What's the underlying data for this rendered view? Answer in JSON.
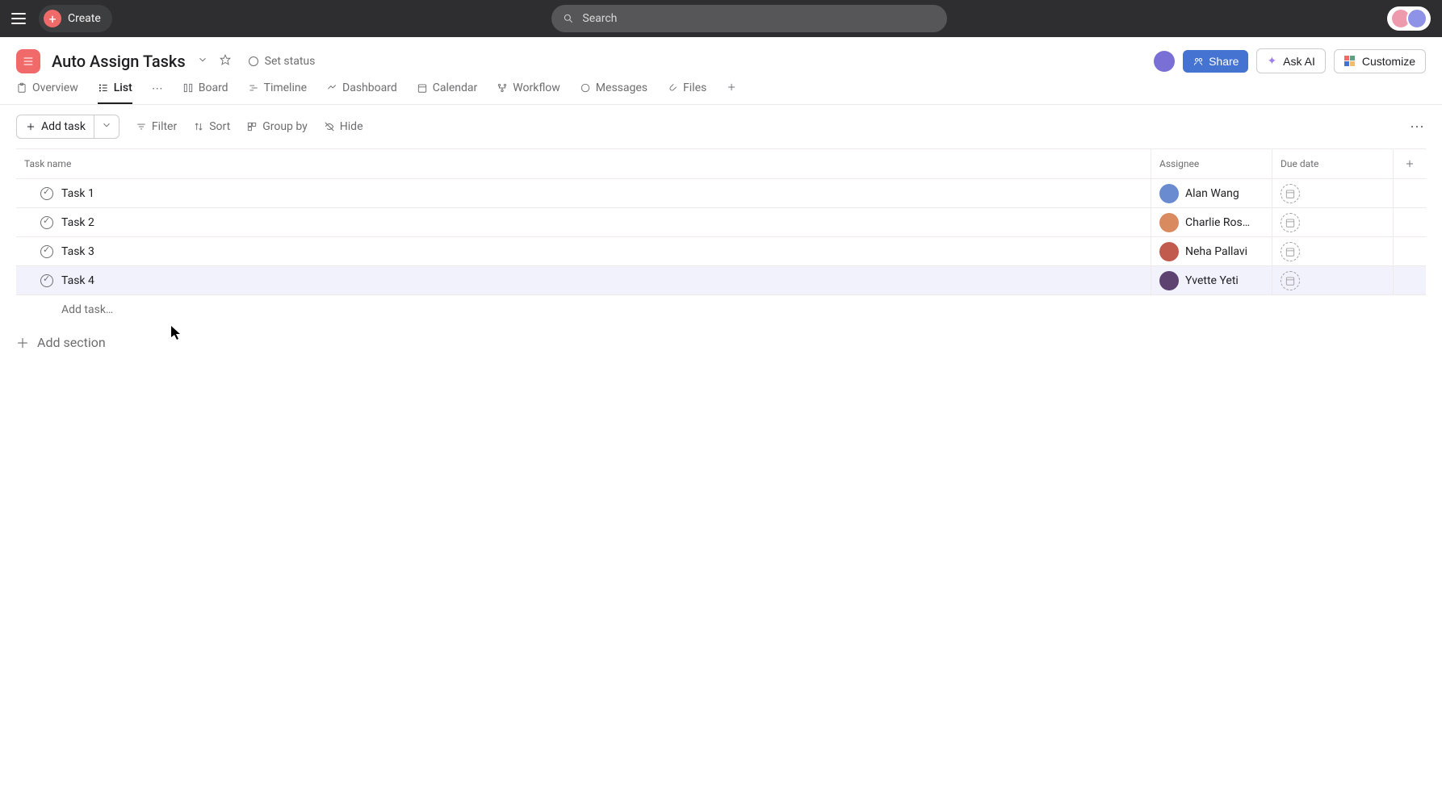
{
  "topbar": {
    "create_label": "Create",
    "search_placeholder": "Search"
  },
  "project": {
    "title": "Auto Assign Tasks",
    "set_status_label": "Set status",
    "share_label": "Share",
    "ask_ai_label": "Ask AI",
    "customize_label": "Customize"
  },
  "tabs": [
    {
      "label": "Overview",
      "icon": "overview"
    },
    {
      "label": "List",
      "icon": "list",
      "active": true
    },
    {
      "label": "Board",
      "icon": "board"
    },
    {
      "label": "Timeline",
      "icon": "timeline"
    },
    {
      "label": "Dashboard",
      "icon": "dashboard"
    },
    {
      "label": "Calendar",
      "icon": "calendar"
    },
    {
      "label": "Workflow",
      "icon": "workflow"
    },
    {
      "label": "Messages",
      "icon": "messages"
    },
    {
      "label": "Files",
      "icon": "files"
    }
  ],
  "toolbar": {
    "add_task_label": "Add task",
    "filter_label": "Filter",
    "sort_label": "Sort",
    "group_by_label": "Group by",
    "hide_label": "Hide"
  },
  "columns": {
    "name": "Task name",
    "assignee": "Assignee",
    "due_date": "Due date"
  },
  "tasks": [
    {
      "name": "Task 1",
      "assignee": "Alan Wang",
      "highlight": false,
      "avatar_class": "c1"
    },
    {
      "name": "Task 2",
      "assignee": "Charlie Ros…",
      "highlight": false,
      "avatar_class": "c2"
    },
    {
      "name": "Task 3",
      "assignee": "Neha Pallavi",
      "highlight": false,
      "avatar_class": "c3"
    },
    {
      "name": "Task 4",
      "assignee": "Yvette Yeti",
      "highlight": true,
      "avatar_class": "c4"
    }
  ],
  "add_task_inline": "Add task…",
  "add_section_label": "Add section"
}
